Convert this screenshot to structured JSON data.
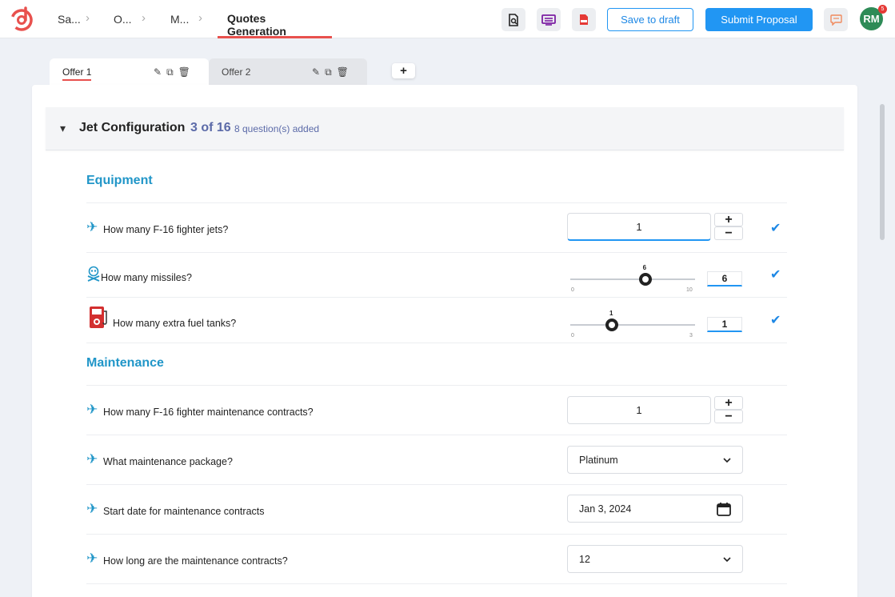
{
  "header": {
    "breadcrumbs": [
      "Sa...",
      "O...",
      "M..."
    ],
    "active_crumb": "Quotes Generation",
    "save_draft_label": "Save to draft",
    "submit_label": "Submit Proposal",
    "avatar_initials": "RM",
    "notification_count": "5"
  },
  "tabs": [
    {
      "label": "Offer 1",
      "active": true
    },
    {
      "label": "Offer 2",
      "active": false
    }
  ],
  "tab_add_label": "+",
  "section": {
    "title": "Jet Configuration",
    "count": "3 of 16",
    "note": "8 question(s) added"
  },
  "groups": {
    "equipment": {
      "title": "Equipment",
      "questions": [
        {
          "label": "How many F-16 fighter jets?",
          "value": "1"
        },
        {
          "label": "How many missiles?",
          "value": "6",
          "min": "0",
          "max": "10",
          "fraction": 0.6
        },
        {
          "label": "How many extra fuel tanks?",
          "value": "1",
          "min": "0",
          "max": "3",
          "fraction": 0.333
        }
      ]
    },
    "maintenance": {
      "title": "Maintenance",
      "questions": [
        {
          "label": "How many F-16 fighter maintenance contracts?",
          "value": "1"
        },
        {
          "label": "What maintenance package?",
          "value": "Platinum"
        },
        {
          "label": "Start date for maintenance contracts",
          "value": "Jan 3, 2024"
        },
        {
          "label": "How long are the maintenance contracts?",
          "value": "12"
        }
      ]
    }
  },
  "stepper": {
    "plus": "+",
    "minus": "−"
  },
  "icons": {
    "plane": "✈",
    "check": "✔"
  },
  "colors": {
    "accent": "#2196f3",
    "group_title": "#2196c8",
    "count": "#5b6aa8",
    "avatar": "#2e8b57",
    "active_tab_underline": "#e8514e"
  }
}
